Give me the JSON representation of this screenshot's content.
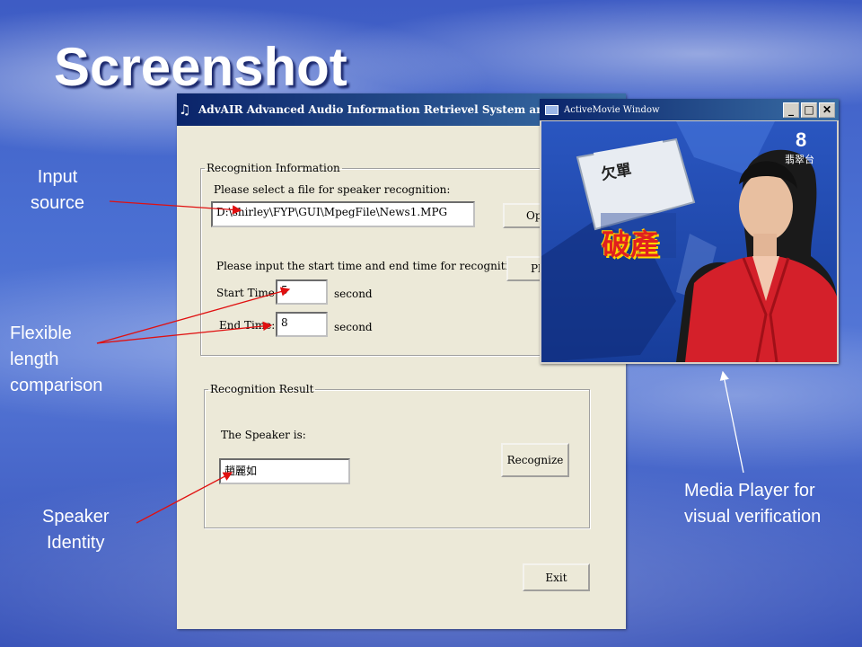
{
  "slide": {
    "title": "Screenshot"
  },
  "app": {
    "title": "AdvAIR Advanced Audio Information Retrievel System and its Appli",
    "recognition_info": {
      "legend": "Recognition Information",
      "file_prompt": "Please select a file for speaker recognition:",
      "file_path": "D:\\shirley\\FYP\\GUI\\MpegFile\\News1.MPG",
      "open_button": "Op",
      "time_prompt": "Please input the start time and end time for recognition:",
      "play_button": "Pl",
      "start_label": "Start Time:",
      "start_value": "5",
      "end_label": "End Time:",
      "end_value": "8",
      "unit": "second"
    },
    "recognition_result": {
      "legend": "Recognition Result",
      "speaker_label": "The Speaker is:",
      "speaker_value": "趙麗如",
      "recognize_button": "Recognize"
    },
    "exit_button": "Exit"
  },
  "media_player": {
    "title": "ActiveMovie Window",
    "buttons": {
      "minimize": "_",
      "maximize": "□",
      "close": "✕"
    },
    "video": {
      "board_text": "欠單",
      "headline": "破產",
      "channel_number": "8",
      "channel_name": "翡翠台"
    }
  },
  "annotations": {
    "input_source": [
      "Input",
      "source"
    ],
    "flexible": [
      "Flexible",
      "length",
      "comparison"
    ],
    "speaker_identity": [
      "Speaker",
      "Identity"
    ],
    "media_player": [
      "Media Player for",
      "visual verification"
    ]
  },
  "colors": {
    "arrow": "#e01010",
    "titlebar": "#0a246a",
    "dialog_bg": "#ece9d8"
  }
}
